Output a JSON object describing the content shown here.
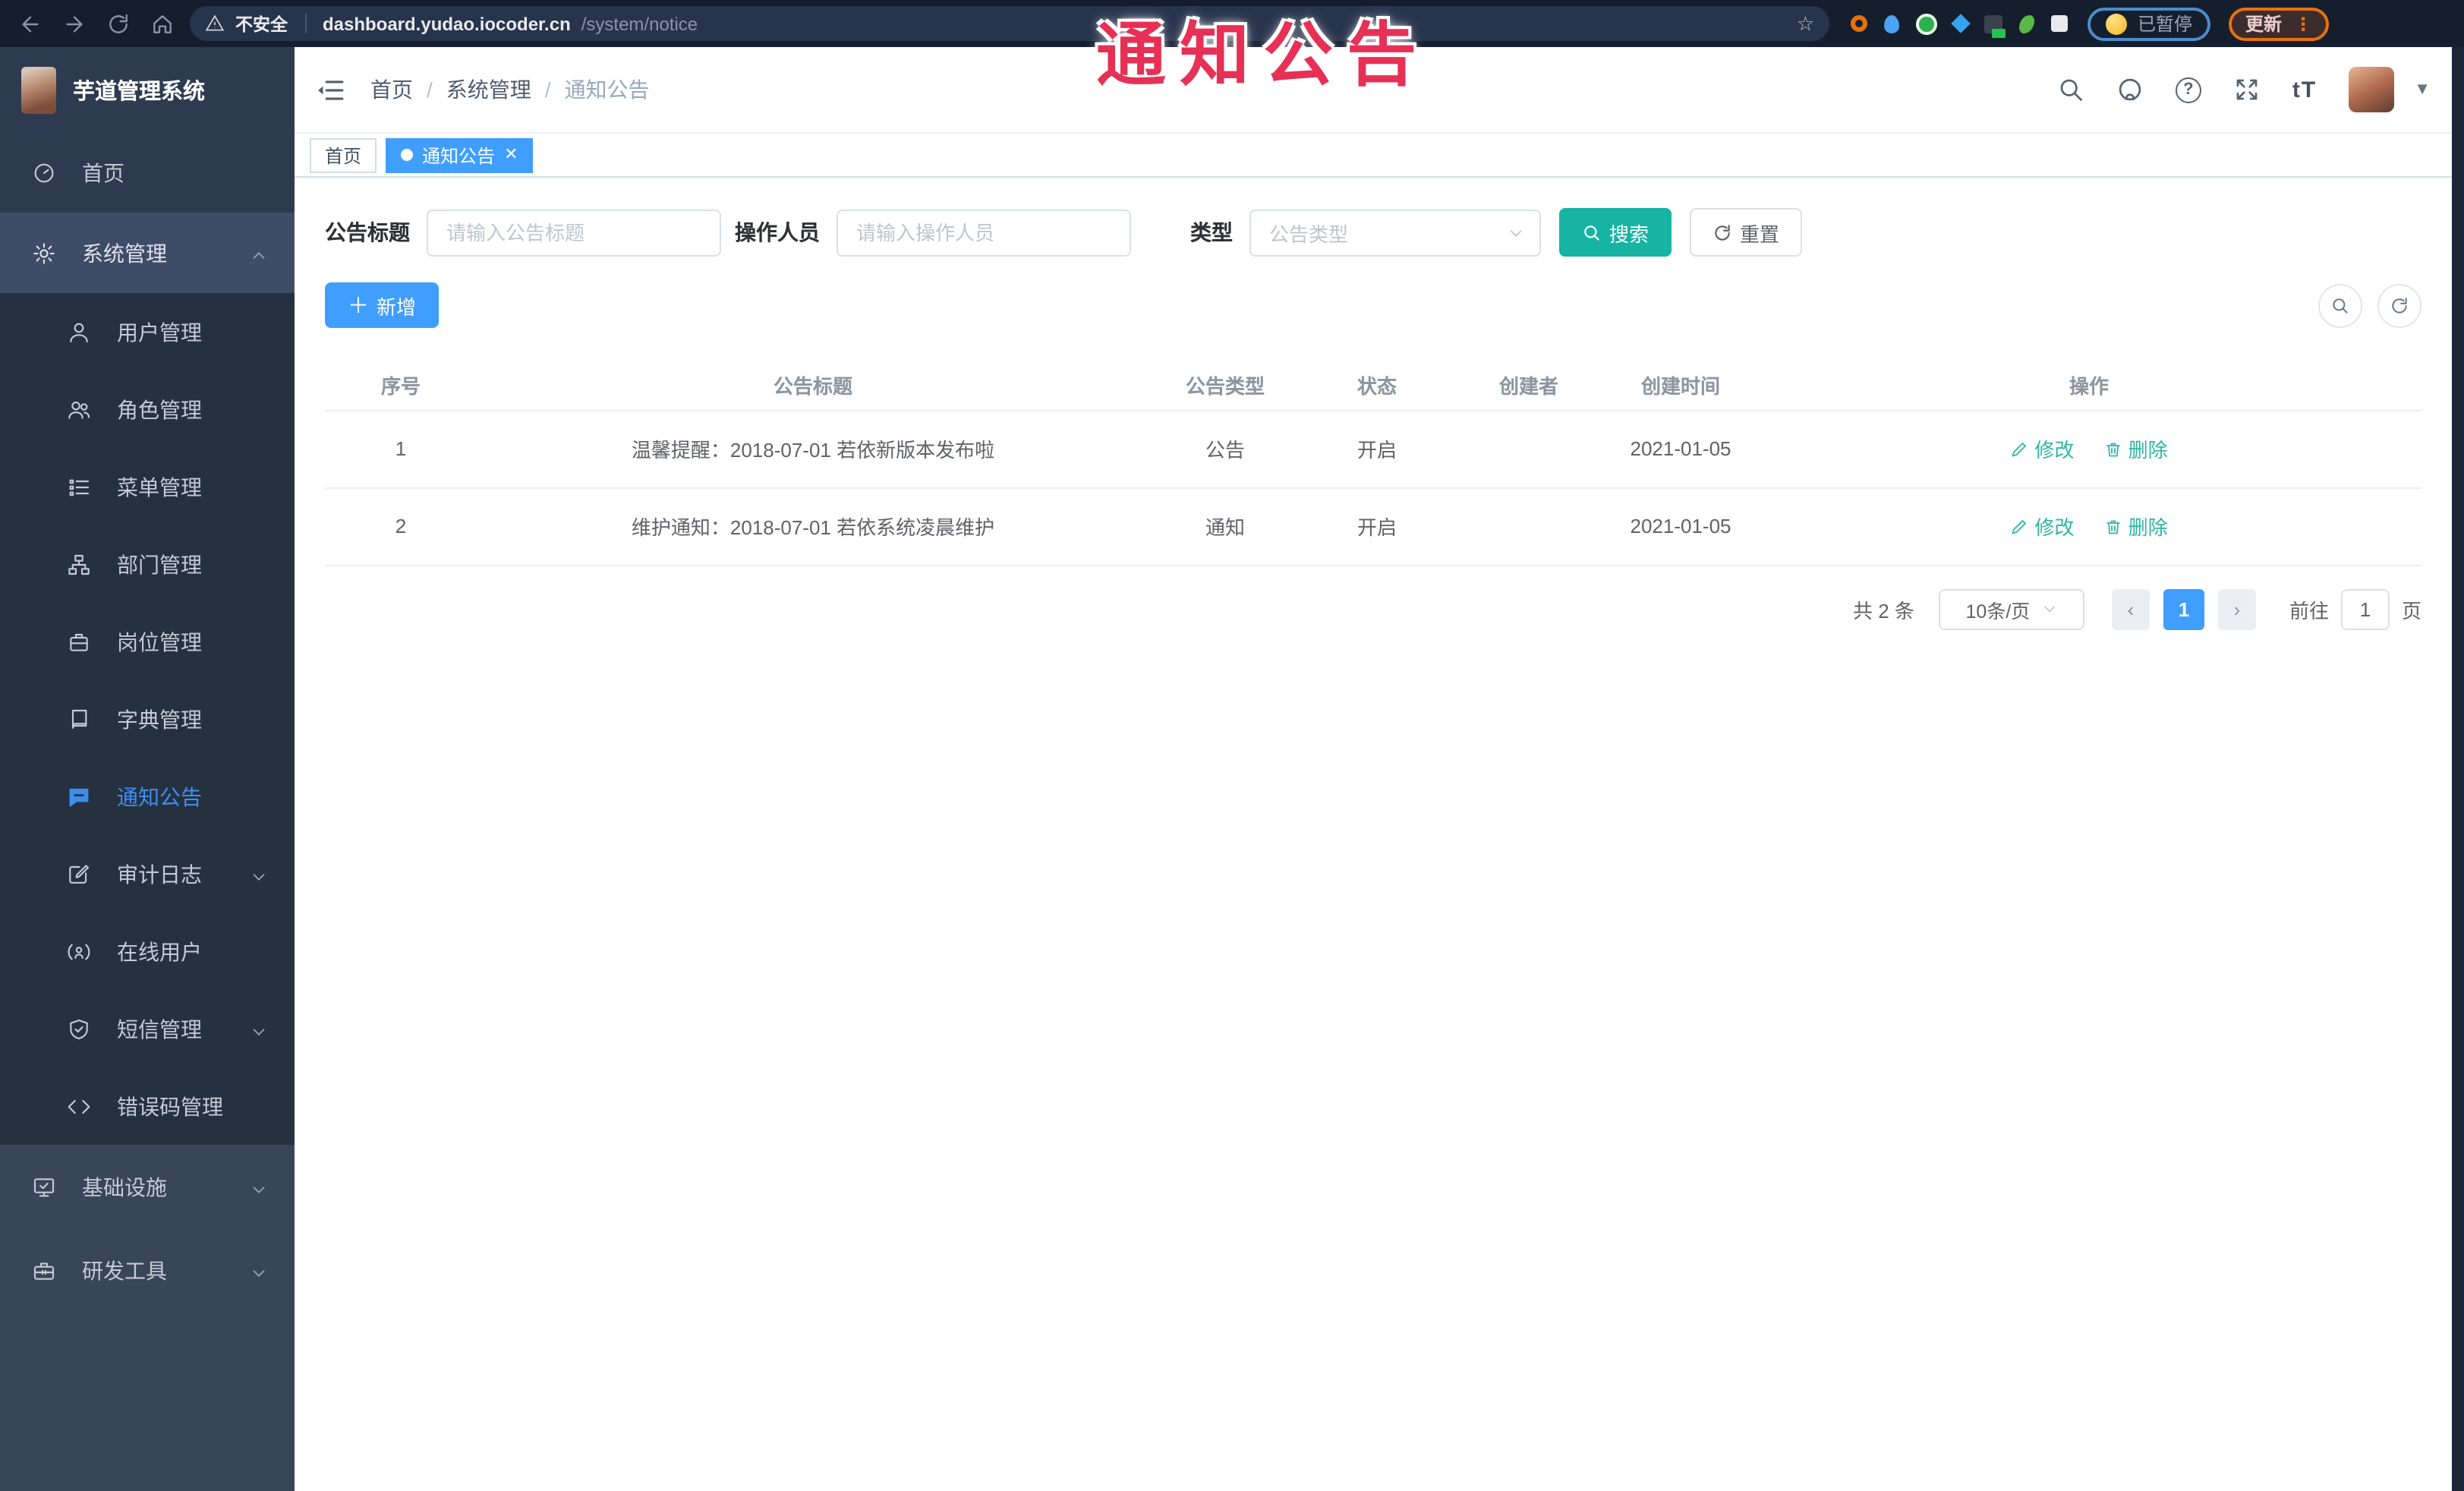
{
  "overlay": {
    "text": "通知公告",
    "color": "#e73055"
  },
  "browser": {
    "security_label": "不安全",
    "url_domain": "dashboard.yudao.iocoder.cn",
    "url_path": "/system/notice",
    "paused_label": "已暂停",
    "update_label": "更新"
  },
  "sidebar": {
    "title": "芋道管理系统",
    "items": [
      {
        "label": "首页"
      },
      {
        "label": "系统管理"
      },
      {
        "label": "用户管理"
      },
      {
        "label": "角色管理"
      },
      {
        "label": "菜单管理"
      },
      {
        "label": "部门管理"
      },
      {
        "label": "岗位管理"
      },
      {
        "label": "字典管理"
      },
      {
        "label": "通知公告"
      },
      {
        "label": "审计日志"
      },
      {
        "label": "在线用户"
      },
      {
        "label": "短信管理"
      },
      {
        "label": "错误码管理"
      },
      {
        "label": "基础设施"
      },
      {
        "label": "研发工具"
      }
    ]
  },
  "header": {
    "breadcrumb": [
      "首页",
      "系统管理",
      "通知公告"
    ]
  },
  "tabs": [
    {
      "label": "首页"
    },
    {
      "label": "通知公告"
    }
  ],
  "filters": {
    "title_label": "公告标题",
    "title_placeholder": "请输入公告标题",
    "operator_label": "操作人员",
    "operator_placeholder": "请输入操作人员",
    "type_label": "类型",
    "type_placeholder": "公告类型",
    "search_label": "搜索",
    "reset_label": "重置"
  },
  "toolbar": {
    "add_label": "新增"
  },
  "table": {
    "headers": [
      "序号",
      "公告标题",
      "公告类型",
      "状态",
      "创建者",
      "创建时间",
      "操作"
    ],
    "rows": [
      {
        "no": "1",
        "title": "温馨提醒：2018-07-01 若依新版本发布啦",
        "type": "公告",
        "status": "开启",
        "creator": "",
        "created": "2021-01-05"
      },
      {
        "no": "2",
        "title": "维护通知：2018-07-01 若依系统凌晨维护",
        "type": "通知",
        "status": "开启",
        "creator": "",
        "created": "2021-01-05"
      }
    ],
    "edit_label": "修改",
    "delete_label": "删除"
  },
  "pagination": {
    "total": "共 2 条",
    "page_size": "10条/页",
    "current": "1",
    "goto_label": "前往",
    "goto_value": "1",
    "page_unit": "页"
  },
  "colors": {
    "primary": "#409eff",
    "search_teal": "#17b3a3",
    "sidebar_bg": "#2e3a50",
    "submenu_bg": "#263140"
  }
}
